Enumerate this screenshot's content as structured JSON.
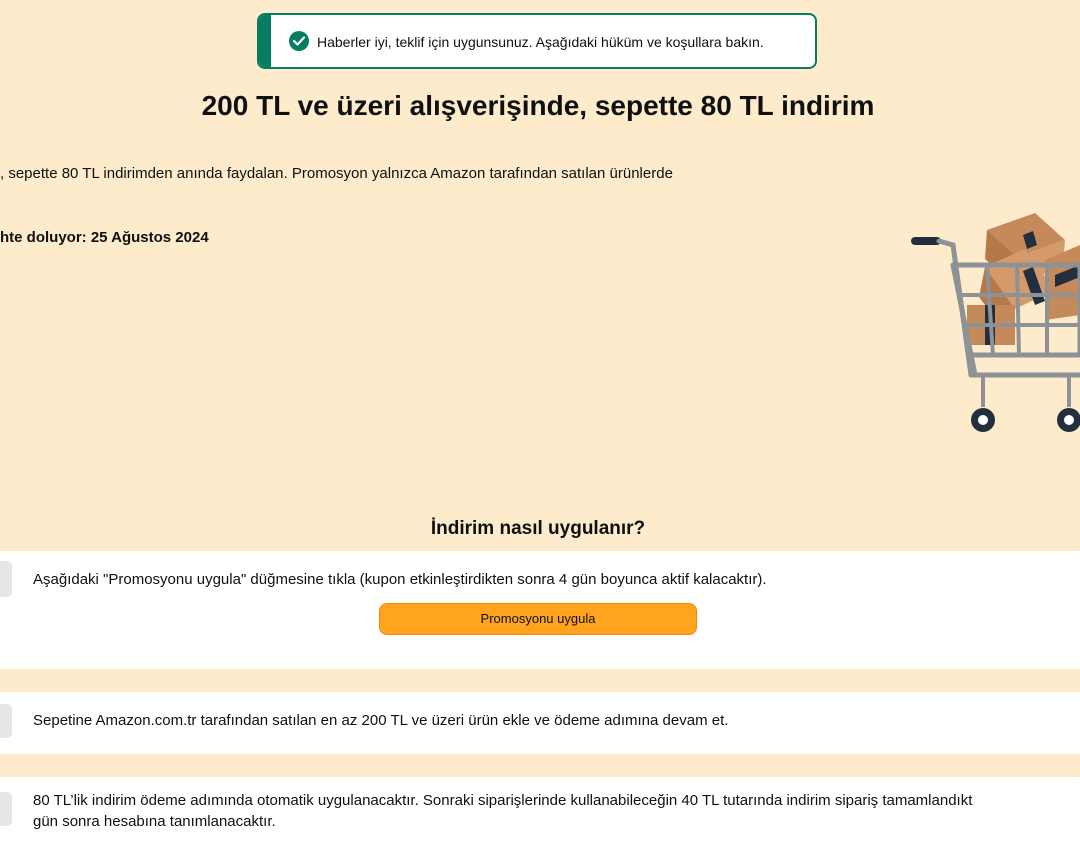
{
  "banner": {
    "message": "Haberler iyi, teklif için uygunsunuz. Aşağıdaki hüküm ve koşullara bakın.",
    "icon": "check-circle-icon",
    "accent": "#067d62"
  },
  "promo": {
    "title": "200 TL ve üzeri alışverişinde, sepette 80 TL indirim",
    "description": ", sepette 80 TL indirimden anında faydalan. Promosyon yalnızca Amazon tarafından satılan ürünlerde",
    "expiry": "hte doluyor: 25 Ağustos 2024"
  },
  "how": {
    "title": "İndirim nasıl uygulanır?",
    "steps": [
      {
        "text": "Aşağıdaki \"Promosyonu uygula\" düğmesine tıkla (kupon etkinleştirdikten sonra 4 gün boyunca aktif kalacaktır).",
        "button_label": "Promosyonu uygula"
      },
      {
        "text": "Sepetine Amazon.com.tr tarafından satılan en az 200 TL ve üzeri ürün ekle ve ödeme adımına devam et."
      },
      {
        "text_line1": "80 TL’lik indirim ödeme adımında otomatik uygulanacaktır. Sonraki siparişlerinde kullanabileceğin 40 TL tutarında indirim sipariş tamamlandıkt",
        "text_line2": "gün sonra hesabına tanımlanacaktır."
      }
    ]
  },
  "colors": {
    "background": "#fdebcb",
    "button": "#ffa41c",
    "success": "#067d62"
  }
}
